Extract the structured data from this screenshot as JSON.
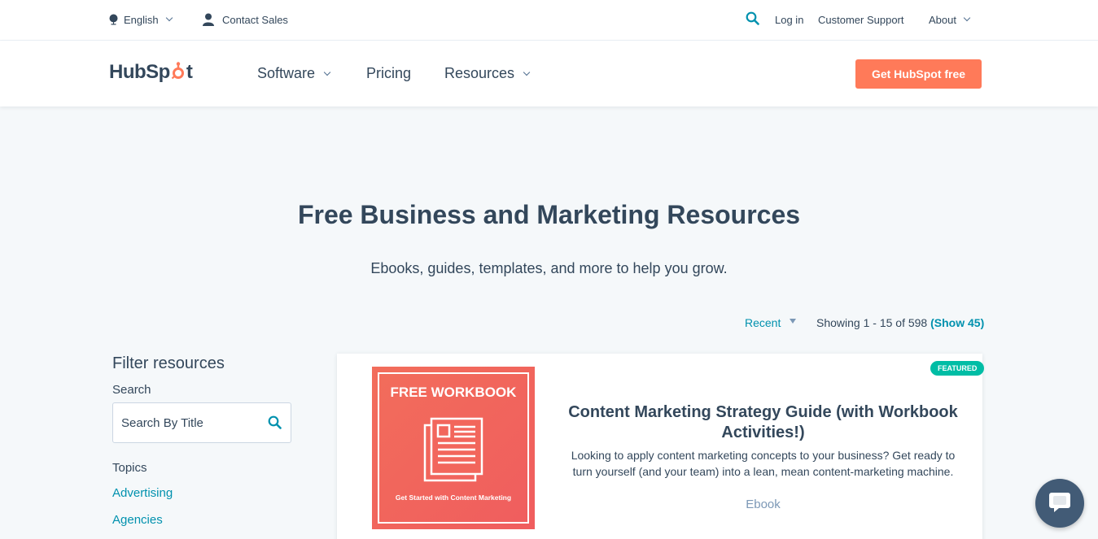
{
  "utility": {
    "language": "English",
    "contact_sales": "Contact Sales",
    "log_in": "Log in",
    "customer_support": "Customer Support",
    "about": "About"
  },
  "nav": {
    "logo": {
      "part1": "HubSp",
      "part2": "t"
    },
    "software": "Software",
    "pricing": "Pricing",
    "resources": "Resources",
    "cta": "Get HubSpot free"
  },
  "hero": {
    "title": "Free Business and Marketing Resources",
    "subtitle": "Ebooks, guides, templates, and more to help you grow."
  },
  "listing": {
    "sort_label": "Recent",
    "count_text": "Showing 1 - 15 of 598",
    "show_more": "(Show 45)"
  },
  "sidebar": {
    "filter_title": "Filter resources",
    "search_label": "Search",
    "search_placeholder": "Search By Title",
    "topics_label": "Topics",
    "topics": [
      "Advertising",
      "Agencies"
    ]
  },
  "card": {
    "badge": "FEATURED",
    "thumb_heading": "FREE WORKBOOK",
    "thumb_footer": "Get Started with Content Marketing",
    "title": "Content Marketing Strategy Guide (with Workbook Activities!)",
    "description": "Looking to apply content marketing concepts to your business? Get ready to turn yourself (and your team) into a lean, mean content-marketing machine.",
    "type": "Ebook"
  },
  "colors": {
    "accent_orange": "#ff7a59",
    "link_teal": "#0091ae",
    "badge_green": "#00bda5",
    "text_dark": "#33475b",
    "background": "#f5f8fa"
  },
  "icons": {
    "language": "globe-icon",
    "contact": "person-icon",
    "search": "search-icon",
    "chat": "chat-bubble-icon"
  }
}
